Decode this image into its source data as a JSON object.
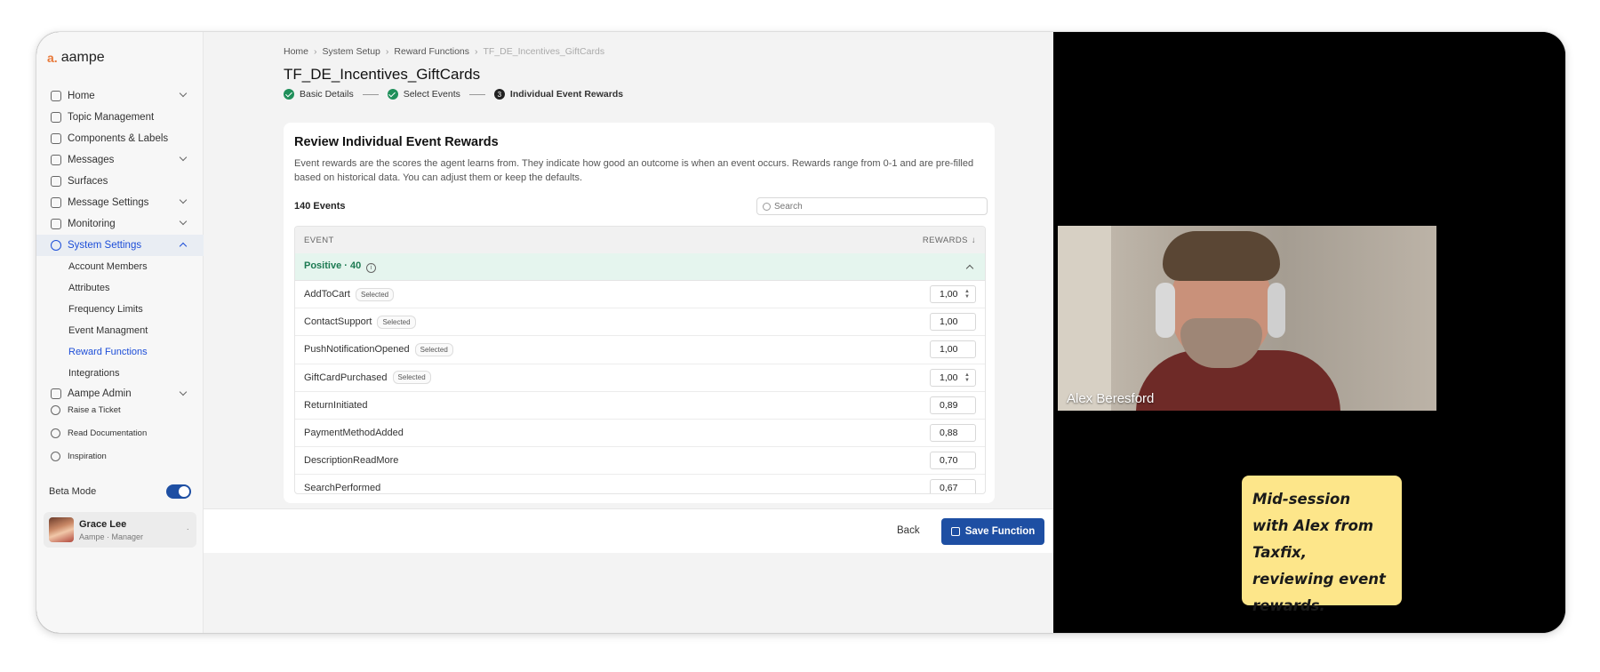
{
  "app": {
    "logo": "aampe",
    "logo_mark": "a."
  },
  "sidebar": {
    "items": [
      {
        "label": "Home",
        "chevron": "down"
      },
      {
        "label": "Topic Management"
      },
      {
        "label": "Components & Labels"
      },
      {
        "label": "Messages",
        "chevron": "down"
      },
      {
        "label": "Surfaces"
      },
      {
        "label": "Message Settings",
        "chevron": "down"
      },
      {
        "label": "Monitoring",
        "chevron": "down"
      },
      {
        "label": "System Settings",
        "chevron": "up",
        "active": true
      }
    ],
    "sub_items": [
      "Account Members",
      "Attributes",
      "Frequency Limits",
      "Event Managment",
      "Reward Functions",
      "Integrations"
    ],
    "admin": {
      "label": "Aampe Admin"
    },
    "small_items": [
      "Raise a Ticket",
      "Read Documentation",
      "Inspiration"
    ],
    "beta_label": "Beta Mode",
    "user": {
      "name": "Grace Lee",
      "role": "Aampe · Manager"
    }
  },
  "breadcrumb": [
    "Home",
    "System Setup",
    "Reward Functions",
    "TF_DE_Incentives_GiftCards"
  ],
  "page_title": "TF_DE_Incentives_GiftCards",
  "steps": [
    {
      "label": "Basic Details",
      "state": "done"
    },
    {
      "label": "Select Events",
      "state": "done"
    },
    {
      "label": "Individual Event Rewards",
      "state": "current",
      "number": "3"
    }
  ],
  "card": {
    "title": "Review Individual Event Rewards",
    "description": "Event rewards are the scores the agent learns from. They indicate how good an outcome is when an event occurs. Rewards range from 0-1 and are pre-filled based on historical data. You can adjust them or keep the defaults.",
    "count": "140 Events",
    "search_placeholder": "Search"
  },
  "table": {
    "col_event": "EVENT",
    "col_rewards": "REWARDS",
    "group_label": "Positive · 40",
    "rows": [
      {
        "event": "AddToCart",
        "badge": "Selected",
        "value": "1,00"
      },
      {
        "event": "ContactSupport",
        "badge": "Selected",
        "value": "1,00"
      },
      {
        "event": "PushNotificationOpened",
        "badge": "Selected",
        "value": "1,00"
      },
      {
        "event": "GiftCardPurchased",
        "badge": "Selected",
        "value": "1,00"
      },
      {
        "event": "ReturnInitiated",
        "badge": "",
        "value": "0,89"
      },
      {
        "event": "PaymentMethodAdded",
        "badge": "",
        "value": "0,88"
      },
      {
        "event": "DescriptionReadMore",
        "badge": "",
        "value": "0,70"
      },
      {
        "event": "SearchPerformed",
        "badge": "",
        "value": "0,67"
      }
    ]
  },
  "footer": {
    "back": "Back",
    "save": "Save Function"
  },
  "video": {
    "participant": "Alex Beresford",
    "note": "Mid-session with Alex from Taxfix, reviewing event rewards."
  },
  "colors": {
    "accent": "#1e4fa3",
    "positive_bg": "#e5f5ee",
    "positive_text": "#1c7a52",
    "note_bg": "#fde68a"
  }
}
